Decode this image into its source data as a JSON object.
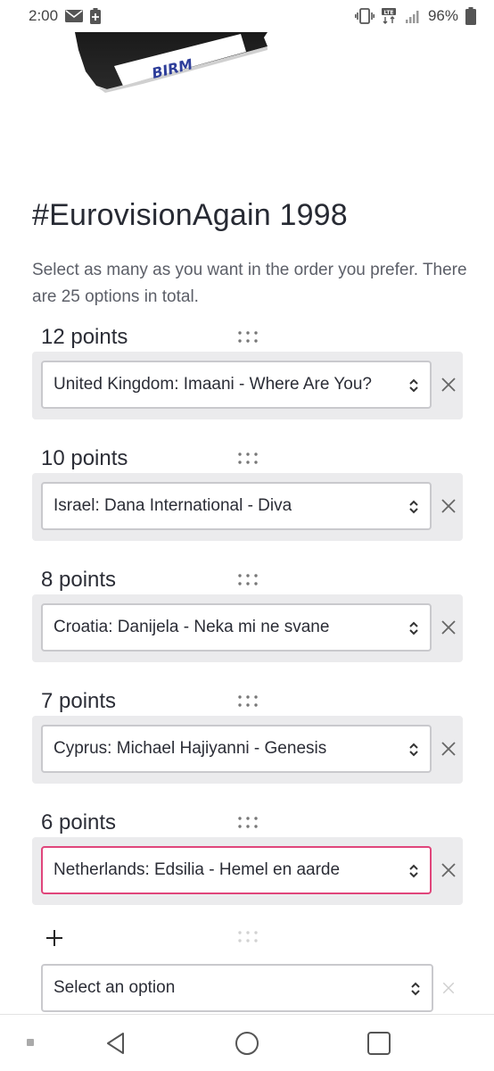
{
  "status_bar": {
    "time": "2:00",
    "battery": "96%",
    "network": "LTE"
  },
  "page": {
    "title": "#EurovisionAgain 1998",
    "description": "Select as many as you want in the order you prefer. There are 25 options in total.",
    "cassette_label": "BIRM"
  },
  "ranks": [
    {
      "label": "12 points",
      "selection": "United Kingdom: Imaani - Where Are You?",
      "active": false
    },
    {
      "label": "10 points",
      "selection": "Israel: Dana International - Diva",
      "active": false
    },
    {
      "label": "8 points",
      "selection": "Croatia: Danijela - Neka mi ne svane",
      "active": false
    },
    {
      "label": "7 points",
      "selection": "Cyprus: Michael Hajiyanni - Genesis",
      "active": false
    },
    {
      "label": "6 points",
      "selection": "Netherlands: Edsilia - Hemel en aarde",
      "active": true
    }
  ],
  "add": {
    "placeholder": "Select an option"
  },
  "colors": {
    "accent_border": "#e0457b",
    "card_bg": "#ebebed",
    "text": "#2b2d36"
  },
  "icons": {
    "drag": "drag-handle-icon",
    "chevron": "chevron-updown-icon",
    "remove": "close-icon",
    "add": "plus-icon"
  }
}
